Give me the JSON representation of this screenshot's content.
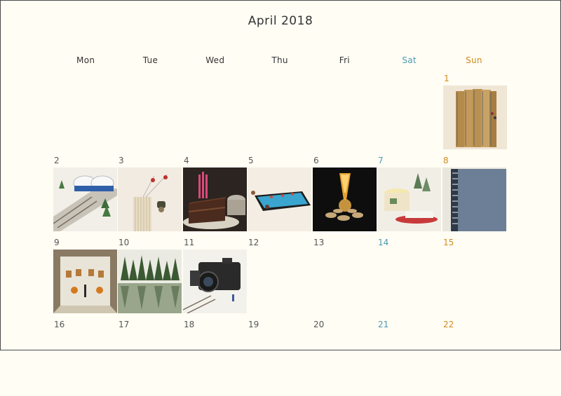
{
  "calendar": {
    "title": "April 2018",
    "weekdays": [
      "Mon",
      "Tue",
      "Wed",
      "Thu",
      "Fri",
      "Sat",
      "Sun"
    ],
    "colors": {
      "saturday": "#4a9ab5",
      "sunday": "#d28a1e",
      "background": "#fffdf4"
    },
    "days": [
      {
        "day": "1",
        "photo": "notebook-spines-photo"
      },
      {
        "day": "2",
        "photo": "bullet-train-slippers-photo"
      },
      {
        "day": "3",
        "photo": "spiderman-toothpicks-photo"
      },
      {
        "day": "4",
        "photo": "chocolate-cake-candles-photo"
      },
      {
        "day": "5",
        "photo": "smartphone-pool-photo"
      },
      {
        "day": "6",
        "photo": "volcano-crackers-photo"
      },
      {
        "day": "7",
        "photo": "pudding-snow-trees-photo"
      },
      {
        "day": "8",
        "photo": "sketchbook-photo"
      },
      {
        "day": "9",
        "photo": "gallery-room-photo"
      },
      {
        "day": "10",
        "photo": "forest-lake-photo"
      },
      {
        "day": "11",
        "photo": "camera-train-photo"
      },
      {
        "day": "12"
      },
      {
        "day": "13"
      },
      {
        "day": "14"
      },
      {
        "day": "15"
      },
      {
        "day": "16"
      },
      {
        "day": "17"
      },
      {
        "day": "18"
      },
      {
        "day": "19"
      },
      {
        "day": "20"
      },
      {
        "day": "21"
      },
      {
        "day": "22"
      }
    ]
  }
}
